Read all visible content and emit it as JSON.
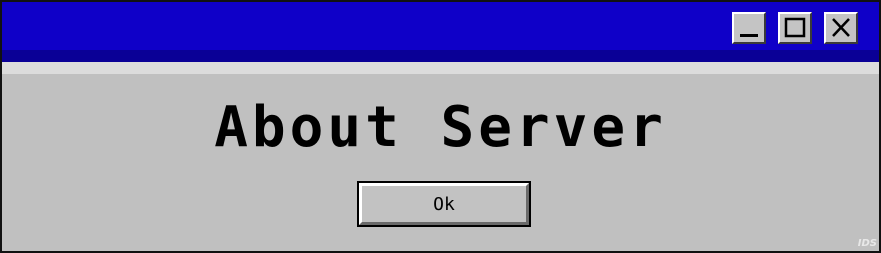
{
  "window": {
    "title_bar_color": "#0f00c8",
    "background_color": "#c0c0c0",
    "controls": [
      {
        "name": "minimize",
        "icon": "minimize-icon"
      },
      {
        "name": "maximize",
        "icon": "maximize-icon"
      },
      {
        "name": "close",
        "icon": "close-icon"
      }
    ]
  },
  "dialog": {
    "heading": "About Server",
    "ok_label": "Ok"
  },
  "corner_mark": "IDS"
}
